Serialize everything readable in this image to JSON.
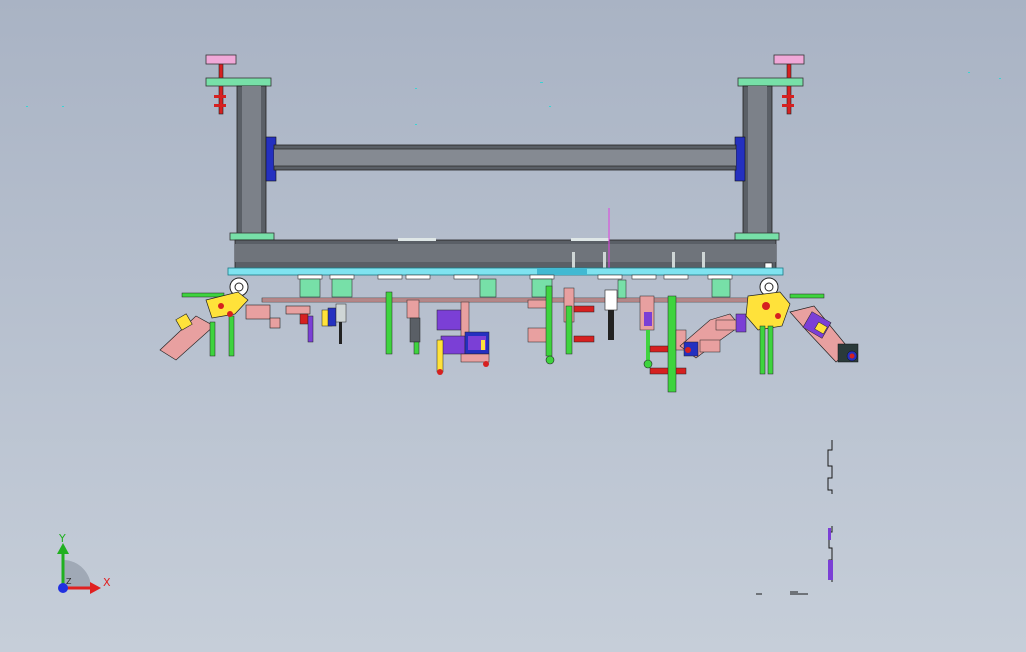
{
  "viewport": {
    "background_top": "#a9b3c4",
    "background_bottom": "#c6ced9"
  },
  "triad": {
    "x_label": "X",
    "y_label": "Y",
    "z_label": "Z",
    "x_color": "#e02020",
    "y_color": "#20b020",
    "z_color": "#2030e0"
  },
  "model": {
    "colors": {
      "steel": "#5a5f66",
      "plate": "#77e0a8",
      "pad": "#f0a8d8",
      "fastener": "#d62020",
      "clamp_pink": "#e8a0a0",
      "cylinder_green": "#3ed43e",
      "block_purple": "#7b3fd6",
      "bracket_yellow": "#ffe23a",
      "rail_cyan": "#7fe3f0",
      "end_plate_blue": "#2430c0"
    }
  }
}
